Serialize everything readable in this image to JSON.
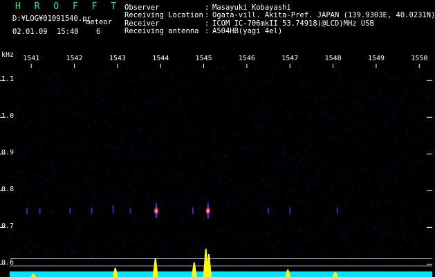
{
  "app": {
    "title": "H R O F F T",
    "file_path": "D:¥LOG¥01091540.pr",
    "mode_label": "meteor",
    "date": "02.01.09",
    "time": "15:40",
    "count": "6"
  },
  "observation": [
    {
      "label": "Observer",
      "value": "Masayuki Kobayashi"
    },
    {
      "label": "Receiving Location",
      "value": "Ogata-vill. Akita-Pref. JAPAN (139.9303E, 40.0231N)"
    },
    {
      "label": "Receiver",
      "value": "ICOM IC-706mkII 53.74918(@LCD)MHz USB"
    },
    {
      "label": "Receiving antenna",
      "value": "A504HB(yagi 4el)"
    }
  ],
  "separator": ":",
  "y_axis": {
    "unit": "kHz",
    "ticks": [
      "1.1",
      "1.0",
      "0.9",
      "0.8",
      "0.7",
      "0.6"
    ],
    "tick_values": [
      1.1,
      1.0,
      0.9,
      0.8,
      0.7,
      0.6
    ]
  },
  "x_axis": {
    "ticks": [
      "1541",
      "1542",
      "1543",
      "1544",
      "1545",
      "1546",
      "1547",
      "1548",
      "1549",
      "1550"
    ],
    "tick_values": [
      1541,
      1542,
      1543,
      1544,
      1545,
      1546,
      1547,
      1548,
      1549,
      1550
    ]
  },
  "colors": {
    "background": "#000000",
    "title": "#00ff7f",
    "text": "#ffffff",
    "spectrum": "#00e5ff",
    "peaks": "#ffff00",
    "noise": "#0a0a4a"
  },
  "chart_data": {
    "type": "heatmap",
    "title": "",
    "xlabel": "",
    "ylabel": "kHz",
    "xlim": [
      1540.5,
      1550.3
    ],
    "ylim": [
      0.58,
      1.21
    ],
    "echo_band_khz": 0.745,
    "echoes": [
      {
        "x": 1540.9,
        "y": 0.745,
        "intensity": 0.3
      },
      {
        "x": 1541.2,
        "y": 0.745,
        "intensity": 0.3
      },
      {
        "x": 1541.9,
        "y": 0.745,
        "intensity": 0.25
      },
      {
        "x": 1542.4,
        "y": 0.745,
        "intensity": 0.3
      },
      {
        "x": 1542.9,
        "y": 0.75,
        "intensity": 0.45
      },
      {
        "x": 1543.3,
        "y": 0.745,
        "intensity": 0.25
      },
      {
        "x": 1543.9,
        "y": 0.745,
        "intensity": 0.95
      },
      {
        "x": 1544.75,
        "y": 0.745,
        "intensity": 0.35
      },
      {
        "x": 1545.1,
        "y": 0.745,
        "intensity": 1.0
      },
      {
        "x": 1546.5,
        "y": 0.745,
        "intensity": 0.3
      },
      {
        "x": 1547.0,
        "y": 0.745,
        "intensity": 0.35
      },
      {
        "x": 1548.1,
        "y": 0.745,
        "intensity": 0.3
      }
    ],
    "reference_lines_khz": [
      0.615,
      0.595
    ],
    "peaks": [
      {
        "x": 1543.88,
        "height": 0.45
      },
      {
        "x": 1544.78,
        "height": 0.35
      },
      {
        "x": 1545.05,
        "height": 0.68
      },
      {
        "x": 1545.12,
        "height": 0.55
      },
      {
        "x": 1542.95,
        "height": 0.22
      },
      {
        "x": 1546.95,
        "height": 0.18
      },
      {
        "x": 1548.05,
        "height": 0.12
      },
      {
        "x": 1541.05,
        "height": 0.08
      }
    ]
  }
}
